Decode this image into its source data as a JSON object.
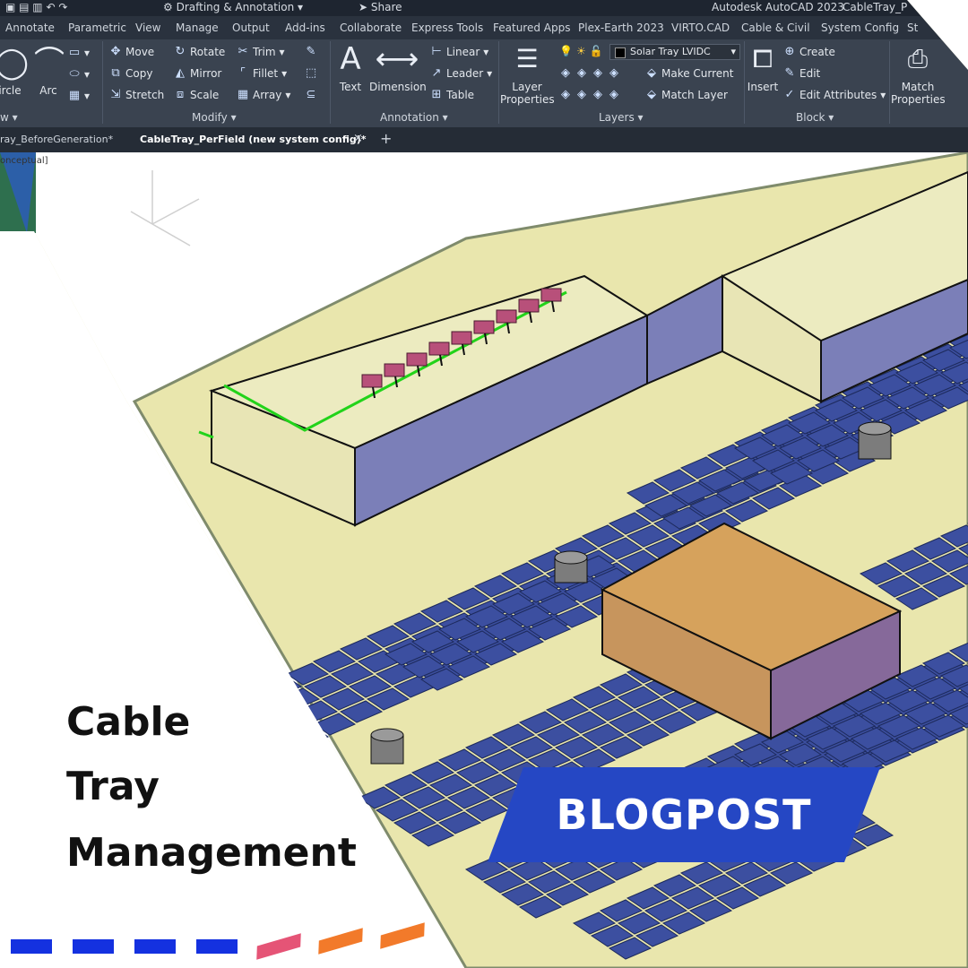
{
  "ribbon": {
    "quick_access": {
      "workspace": "Drafting & Annotation",
      "share": "Share",
      "app_title": "Autodesk AutoCAD 2023",
      "file_title": "CableTray_P"
    },
    "tabs": [
      "Annotate",
      "Parametric",
      "View",
      "Manage",
      "Output",
      "Add-ins",
      "Collaborate",
      "Express Tools",
      "Featured Apps",
      "Plex-Earth 2023",
      "VIRTO.CAD",
      "Cable & Civil",
      "System Config",
      "St"
    ],
    "draw": {
      "circle": "ircle",
      "arc": "Arc",
      "group": "w"
    },
    "modify": {
      "move": "Move",
      "rotate": "Rotate",
      "trim": "Trim",
      "copy": "Copy",
      "mirror": "Mirror",
      "fillet": "Fillet",
      "stretch": "Stretch",
      "scale": "Scale",
      "array": "Array",
      "group": "Modify"
    },
    "annotation": {
      "text": "Text",
      "dimension": "Dimension",
      "linear": "Linear",
      "leader": "Leader",
      "table": "Table",
      "group": "Annotation"
    },
    "layers": {
      "layer_properties_1": "Layer",
      "layer_properties_2": "Properties",
      "current_layer": "Solar Tray LVIDC",
      "make_current": "Make Current",
      "match_layer": "Match Layer",
      "group": "Layers"
    },
    "block": {
      "insert": "Insert",
      "create": "Create",
      "edit": "Edit",
      "edit_attributes": "Edit Attributes",
      "group": "Block"
    },
    "properties": {
      "match_1": "Match",
      "match_2": "Properties"
    }
  },
  "document_tabs": {
    "tab1": "ray_BeforeGeneration*",
    "tab2": "CableTray_PerField (new system config)*",
    "close": "×",
    "new": "+"
  },
  "viewport_label": "onceptual]",
  "headline": {
    "line1": "Cable",
    "line2": "Tray",
    "line3": "Management"
  },
  "badge": "BLOGPOST",
  "colors": {
    "badge": "#2547c4",
    "ground": "#e9e6ad",
    "panel": "#3c4fa0",
    "wall": "#7b7fb8",
    "box": "#cf9a52"
  },
  "dashes": [
    "#1431e0",
    "#1431e0",
    "#1431e0",
    "#1431e0",
    "#e55476",
    "#f27a2a",
    "#f27a2a"
  ]
}
